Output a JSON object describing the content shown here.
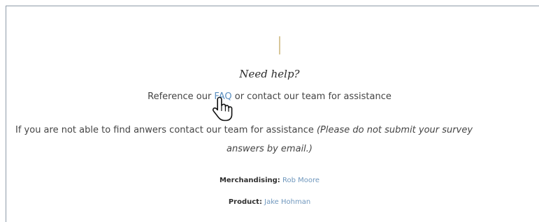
{
  "help": {
    "heading": "Need help?",
    "reference_prefix": "Reference our ",
    "faq_link": "FAQ",
    "reference_suffix": " or contact our team for assistance"
  },
  "info": {
    "line1_text": "If you are not able to find anwers contact our team for assistance ",
    "line1_note": "(Please do not submit your survey",
    "line2_note": "answers by email.)"
  },
  "contacts": [
    {
      "label": "Merchandising:",
      "name": "Rob Moore"
    },
    {
      "label": "Product:",
      "name": "Jake Hohman"
    }
  ],
  "colors": {
    "link": "#5b8fc0",
    "accent_divider": "#d8c79a",
    "frame_rule": "#8e9aa8"
  },
  "icons": {
    "cursor": "hand-pointer-cursor-icon"
  }
}
